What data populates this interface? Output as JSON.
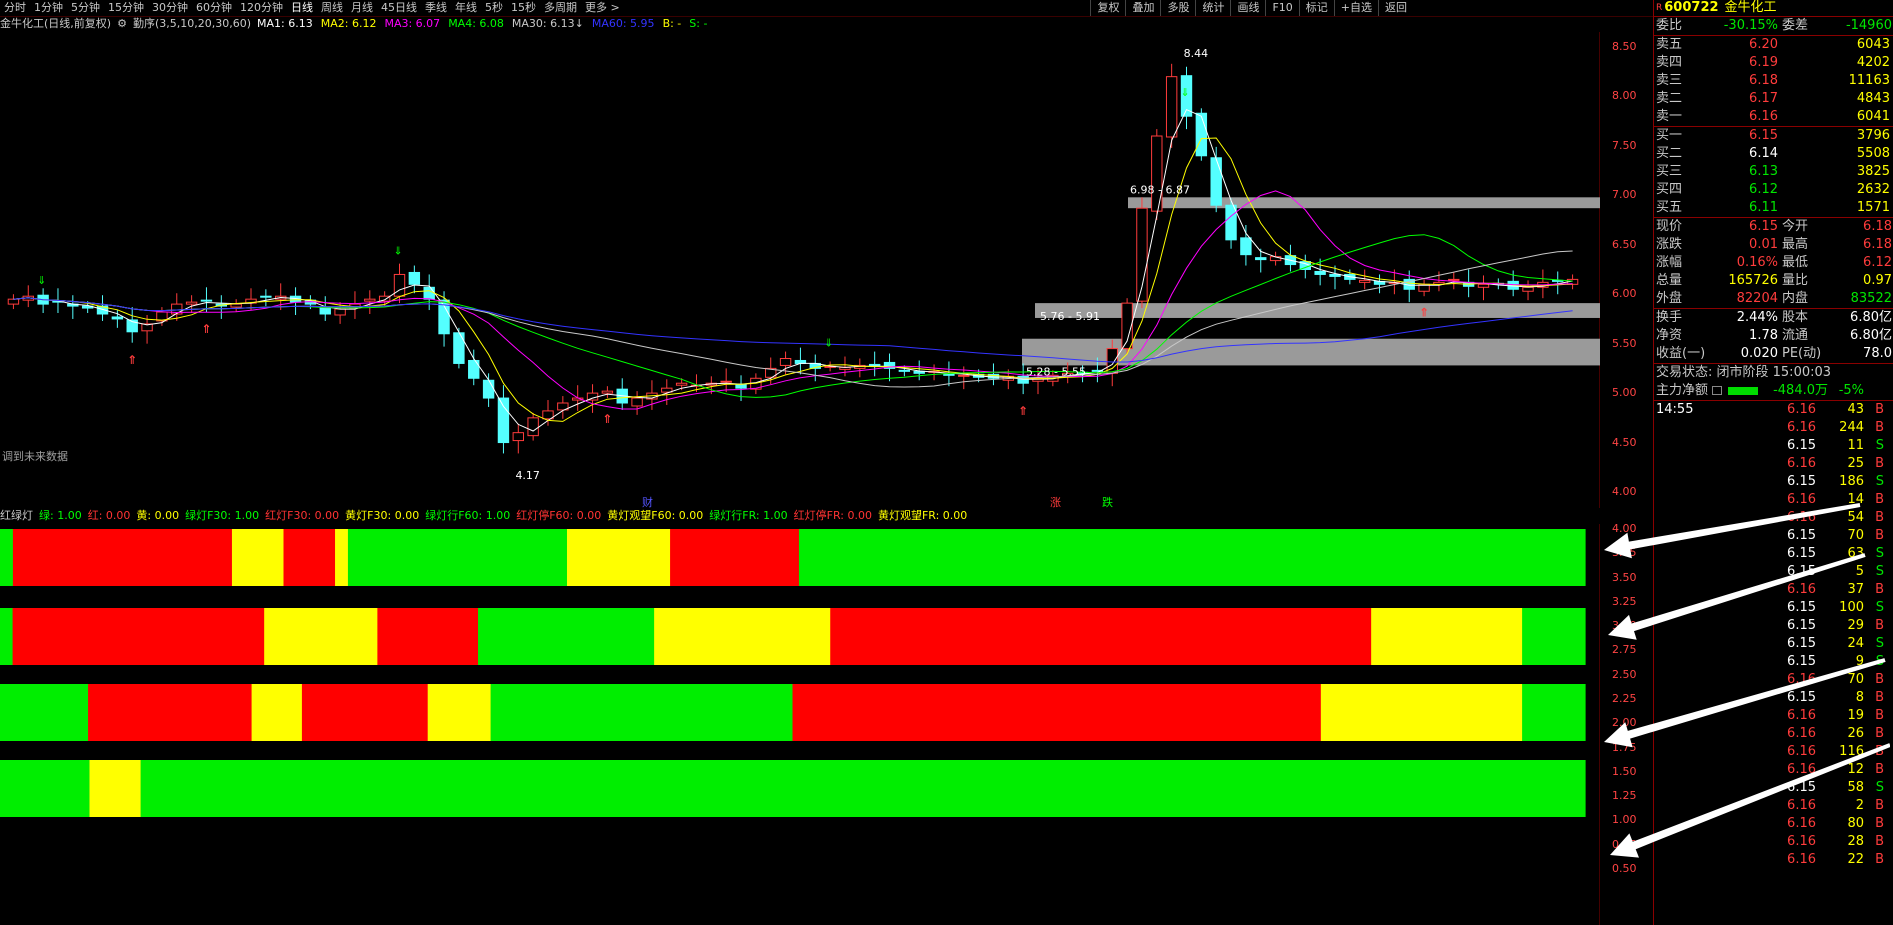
{
  "toolbar": {
    "periods": [
      "分时",
      "1分钟",
      "5分钟",
      "15分钟",
      "30分钟",
      "60分钟",
      "120分钟",
      "日线",
      "周线",
      "月线",
      "45日线",
      "季线",
      "年线",
      "5秒",
      "15秒",
      "多周期",
      "更多 >"
    ],
    "active_period": "日线",
    "right_tools": [
      "复权",
      "叠加",
      "多股",
      "统计",
      "画线",
      "F10",
      "标记",
      "+自选",
      "返回"
    ]
  },
  "chart_header": {
    "title": "金牛化工(日线,前复权)",
    "indicator": "勤序(3,5,10,20,30,60)",
    "ma": [
      {
        "label": "MA1: 6.13",
        "color": "#ffffff"
      },
      {
        "label": "MA2: 6.12",
        "color": "#ffff00"
      },
      {
        "label": "MA3: 6.07",
        "color": "#ff00ff"
      },
      {
        "label": "MA4: 6.08",
        "color": "#00ff00"
      },
      {
        "label": "MA30: 6.13↓",
        "color": "#c8c8c8"
      },
      {
        "label": "MA60: 5.95",
        "color": "#3333ff"
      },
      {
        "label": "B: -",
        "color": "#ffff00"
      },
      {
        "label": "S: -",
        "color": "#00ff00"
      }
    ]
  },
  "main_chart": {
    "y_ticks": [
      "8.50",
      "8.00",
      "7.50",
      "7.00",
      "6.50",
      "6.00",
      "5.50",
      "5.00",
      "4.50",
      "4.00"
    ],
    "annotations": {
      "high": "8.44",
      "low": "4.17",
      "zone1": "6.98 - 6.87",
      "zone2": "5.76 - 5.91",
      "zone3": "5.28 - 5.55",
      "future_text": "调到未来数据",
      "marker_cai": "财",
      "marker_zhang": "涨",
      "marker_die": "跌"
    }
  },
  "indicator_header": {
    "items": [
      {
        "label": "红绿灯",
        "color": "#c8c8c8"
      },
      {
        "label": "绿: 1.00",
        "color": "#00ff00"
      },
      {
        "label": "红: 0.00",
        "color": "#ff3333"
      },
      {
        "label": "黄: 0.00",
        "color": "#ffff00"
      },
      {
        "label": "绿灯F30: 1.00",
        "color": "#00ff00"
      },
      {
        "label": "红灯F30: 0.00",
        "color": "#ff3333"
      },
      {
        "label": "黄灯F30: 0.00",
        "color": "#ffff00"
      },
      {
        "label": "绿灯行F60: 1.00",
        "color": "#00ff00"
      },
      {
        "label": "红灯停F60: 0.00",
        "color": "#ff3333"
      },
      {
        "label": "黄灯观望F60: 0.00",
        "color": "#ffff00"
      },
      {
        "label": "绿灯行FR: 1.00",
        "color": "#00ff00"
      },
      {
        "label": "红灯停FR: 0.00",
        "color": "#ff3333"
      },
      {
        "label": "黄灯观望FR: 0.00",
        "color": "#ffff00"
      }
    ]
  },
  "sub_chart": {
    "y_ticks": [
      "4.00",
      "3.75",
      "3.50",
      "3.25",
      "3.00",
      "2.75",
      "2.50",
      "2.25",
      "2.00",
      "1.75",
      "1.50",
      "1.25",
      "1.00",
      "0.75",
      "0.50"
    ],
    "colors": {
      "G": "#00ee00",
      "R": "#ff0000",
      "Y": "#ffff00"
    },
    "bands": [
      "GRRRRRRRRRRRRRRRRRYYYYRRRRYGGGGGGGGGGGGGGGGGYYYYYYYYRRRRRRRRRRGGGGGGGGGGGGGGGGGGGGGGGGGGGGGGGGGGGGGGGGGGGGGGGGGGGGGGGGGGGGG",
      "GRRRRRRRRRRRRRRRRRRRRYYYYYYYYYRRRRRRRRGGGGGGGGGGGGGGYYYYYYYYYYYYYYRRRRRRRRRRRRRRRRRRRRRRRRRRRRRRRRRRRRRRRRRRRYYYYYYYYYYYYGGGGG",
      "GGGGGGGRRRRRRRRRRRRRYYYYRRRRRRRRRRYYYYYGGGGGGGGGGGGGGGGGGGGGGGGRRRRRRRRRRRRRRRRRRRRRRRRRRRRRRRRRRRRRRRRRRYYYYYYYYYYYYYYYYGGGGG",
      "GGGGGGGYYYYGGGGGGGGGGGGGGGGGGGGGGGGGGGGGGGGGGGGGGGGGGGGGGGGGGGGGGGGGGGGGGGGGGGGGGGGGGGGGGGGGGGGGGGGGGGGGGGGGGGGGGGGGGGGGGGGG"
    ]
  },
  "quote": {
    "code": "600722",
    "name": "金牛化工",
    "weibi_label": "委比",
    "weibi": "-30.15%",
    "weicha_label": "委差",
    "weicha": "-14960",
    "asks": [
      {
        "label": "卖五",
        "price": "6.20",
        "vol": "6043"
      },
      {
        "label": "卖四",
        "price": "6.19",
        "vol": "4202"
      },
      {
        "label": "卖三",
        "price": "6.18",
        "vol": "11163"
      },
      {
        "label": "卖二",
        "price": "6.17",
        "vol": "4843"
      },
      {
        "label": "卖一",
        "price": "6.16",
        "vol": "6041"
      }
    ],
    "bids": [
      {
        "label": "买一",
        "price": "6.15",
        "vol": "3796"
      },
      {
        "label": "买二",
        "price": "6.14",
        "vol": "5508"
      },
      {
        "label": "买三",
        "price": "6.13",
        "vol": "3825"
      },
      {
        "label": "买四",
        "price": "6.12",
        "vol": "2632"
      },
      {
        "label": "买五",
        "price": "6.11",
        "vol": "1571"
      }
    ],
    "stats": [
      {
        "l1": "现价",
        "v1": "6.15",
        "c1": "red",
        "l2": "今开",
        "v2": "6.18",
        "c2": "red"
      },
      {
        "l1": "涨跌",
        "v1": "0.01",
        "c1": "red",
        "l2": "最高",
        "v2": "6.18",
        "c2": "red"
      },
      {
        "l1": "涨幅",
        "v1": "0.16%",
        "c1": "red",
        "l2": "最低",
        "v2": "6.12",
        "c2": "red"
      },
      {
        "l1": "总量",
        "v1": "165726",
        "c1": "yel",
        "l2": "量比",
        "v2": "0.97",
        "c2": "yel"
      },
      {
        "l1": "外盘",
        "v1": "82204",
        "c1": "red",
        "l2": "内盘",
        "v2": "83522",
        "c2": "grn"
      }
    ],
    "stats2": [
      {
        "l1": "换手",
        "v1": "2.44%",
        "l2": "股本",
        "v2": "6.80亿"
      },
      {
        "l1": "净资",
        "v1": "1.78",
        "l2": "流通",
        "v2": "6.80亿"
      },
      {
        "l1": "收益(一)",
        "v1": "0.020",
        "l2": "PE(动)",
        "v2": "78.0"
      }
    ],
    "trade_status": "交易状态: 闭市阶段 15:00:03",
    "main_flow_label": "主力净额",
    "main_flow_value": "-484.0万",
    "main_flow_pct": "-5%",
    "tick_time": "14:55",
    "ticks": [
      {
        "p": "6.16",
        "v": "43",
        "s": "B"
      },
      {
        "p": "6.16",
        "v": "244",
        "s": "B"
      },
      {
        "p": "6.15",
        "v": "11",
        "s": "S"
      },
      {
        "p": "6.16",
        "v": "25",
        "s": "B"
      },
      {
        "p": "6.15",
        "v": "186",
        "s": "S"
      },
      {
        "p": "6.16",
        "v": "14",
        "s": "B"
      },
      {
        "p": "6.16",
        "v": "54",
        "s": "B"
      },
      {
        "p": "6.15",
        "v": "70",
        "s": "B"
      },
      {
        "p": "6.15",
        "v": "63",
        "s": "S"
      },
      {
        "p": "6.15",
        "v": "5",
        "s": "S"
      },
      {
        "p": "6.16",
        "v": "37",
        "s": "B"
      },
      {
        "p": "6.15",
        "v": "100",
        "s": "S"
      },
      {
        "p": "6.15",
        "v": "29",
        "s": "B"
      },
      {
        "p": "6.15",
        "v": "24",
        "s": "S"
      },
      {
        "p": "6.15",
        "v": "9",
        "s": "S"
      },
      {
        "p": "6.16",
        "v": "70",
        "s": "B"
      },
      {
        "p": "6.15",
        "v": "8",
        "s": "B"
      },
      {
        "p": "6.16",
        "v": "19",
        "s": "B"
      },
      {
        "p": "6.16",
        "v": "26",
        "s": "B"
      },
      {
        "p": "6.16",
        "v": "116",
        "s": "B"
      },
      {
        "p": "6.16",
        "v": "12",
        "s": "B"
      },
      {
        "p": "6.15",
        "v": "58",
        "s": "S"
      },
      {
        "p": "6.16",
        "v": "2",
        "s": "B"
      },
      {
        "p": "6.16",
        "v": "80",
        "s": "B"
      },
      {
        "p": "6.16",
        "v": "28",
        "s": "B"
      },
      {
        "p": "6.16",
        "v": "22",
        "s": "B"
      }
    ]
  },
  "chart_data": {
    "type": "candlestick",
    "y_range": [
      4.0,
      8.5
    ],
    "closes": [
      5.95,
      5.98,
      5.9,
      5.92,
      5.88,
      5.86,
      5.8,
      5.75,
      5.62,
      5.7,
      5.82,
      5.9,
      5.92,
      5.93,
      5.88,
      5.9,
      5.95,
      5.97,
      5.98,
      5.92,
      5.9,
      5.8,
      5.85,
      5.9,
      5.95,
      5.98,
      6.2,
      6.1,
      5.95,
      5.6,
      5.3,
      5.15,
      4.95,
      4.5,
      4.6,
      4.75,
      4.82,
      4.9,
      4.95,
      5.0,
      5.02,
      4.9,
      4.95,
      5.0,
      5.05,
      5.1,
      5.08,
      5.1,
      5.12,
      5.05,
      5.15,
      5.25,
      5.35,
      5.3,
      5.25,
      5.27,
      5.26,
      5.28,
      5.28,
      5.25,
      5.22,
      5.2,
      5.22,
      5.18,
      5.18,
      5.16,
      5.15,
      5.17,
      5.1,
      5.15,
      5.18,
      5.2,
      5.2,
      5.22,
      5.45,
      5.91,
      6.87,
      7.6,
      8.2,
      7.8,
      7.4,
      6.9,
      6.55,
      6.4,
      6.35,
      6.38,
      6.3,
      6.25,
      6.2,
      6.18,
      6.15,
      6.14,
      6.1,
      6.12,
      6.05,
      6.1,
      6.12,
      6.15,
      6.08,
      6.1,
      6.1,
      6.05,
      6.07,
      6.12,
      6.13,
      6.15
    ]
  }
}
